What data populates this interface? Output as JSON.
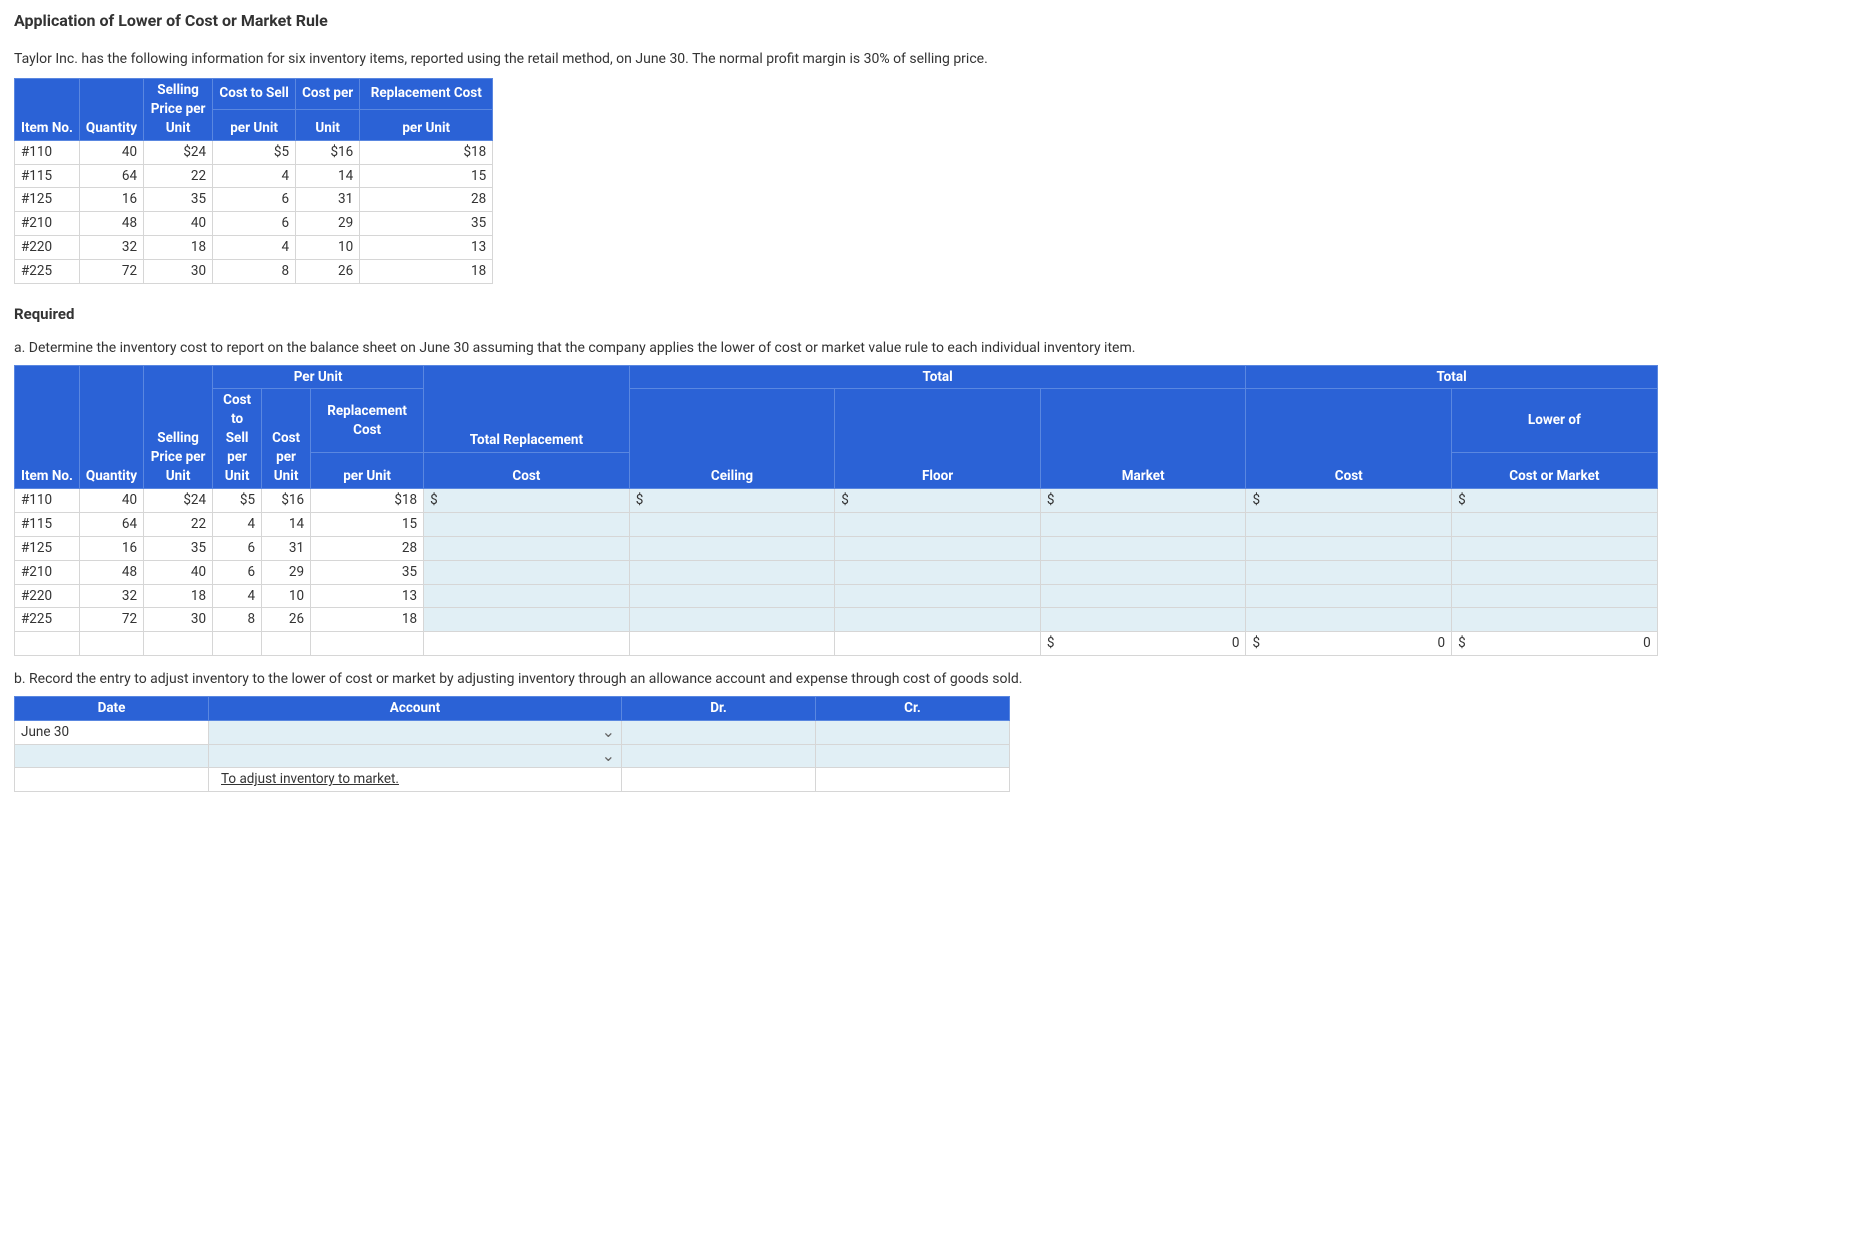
{
  "title": "Application of Lower of Cost or Market Rule",
  "intro": "Taylor Inc. has the following information for six inventory items, reported using the retail method, on June 30. The normal profit margin is 30% of selling price.",
  "table1": {
    "headers": {
      "item_no": "Item No.",
      "quantity": "Quantity",
      "selling_price": "Selling Price per Unit",
      "cost_to_sell": "Cost to Sell",
      "cost_to_sell_sub": "per Unit",
      "cost_per": "Cost per",
      "cost_per_sub": "Unit",
      "replacement": "Replacement Cost",
      "replacement_sub": "per Unit"
    },
    "rows": [
      {
        "item": "#110",
        "qty": "40",
        "sp": "$24",
        "cts": "$5",
        "cpu": "$16",
        "rc": "$18"
      },
      {
        "item": "#115",
        "qty": "64",
        "sp": "22",
        "cts": "4",
        "cpu": "14",
        "rc": "15"
      },
      {
        "item": "#125",
        "qty": "16",
        "sp": "35",
        "cts": "6",
        "cpu": "31",
        "rc": "28"
      },
      {
        "item": "#210",
        "qty": "48",
        "sp": "40",
        "cts": "6",
        "cpu": "29",
        "rc": "35"
      },
      {
        "item": "#220",
        "qty": "32",
        "sp": "18",
        "cts": "4",
        "cpu": "10",
        "rc": "13"
      },
      {
        "item": "#225",
        "qty": "72",
        "sp": "30",
        "cts": "8",
        "cpu": "26",
        "rc": "18"
      }
    ]
  },
  "required_label": "Required",
  "part_a": "a. Determine the inventory cost to report on the balance sheet on June 30 assuming that the company applies the lower of cost or market value rule to each individual inventory item.",
  "table2": {
    "headers": {
      "per_unit": "Per Unit",
      "total1": "Total",
      "total2": "Total",
      "item_no": "Item No.",
      "quantity": "Quantity",
      "selling_price": "Selling Price per Unit",
      "cost_to_sell": "Cost to Sell per Unit",
      "cost_per": "Cost per Unit",
      "replacement": "Replacement Cost",
      "replacement_sub": "per Unit",
      "total_replacement": "Total Replacement",
      "total_replacement_sub": "Cost",
      "ceiling": "Ceiling",
      "floor": "Floor",
      "market": "Market",
      "cost": "Cost",
      "lower_of": "Lower of",
      "lower_of_sub": "Cost or Market"
    },
    "rows": [
      {
        "item": "#110",
        "qty": "40",
        "sp": "$24",
        "cts": "$5",
        "cpu": "$16",
        "rc": "$18"
      },
      {
        "item": "#115",
        "qty": "64",
        "sp": "22",
        "cts": "4",
        "cpu": "14",
        "rc": "15"
      },
      {
        "item": "#125",
        "qty": "16",
        "sp": "35",
        "cts": "6",
        "cpu": "31",
        "rc": "28"
      },
      {
        "item": "#210",
        "qty": "48",
        "sp": "40",
        "cts": "6",
        "cpu": "29",
        "rc": "35"
      },
      {
        "item": "#220",
        "qty": "32",
        "sp": "18",
        "cts": "4",
        "cpu": "10",
        "rc": "13"
      },
      {
        "item": "#225",
        "qty": "72",
        "sp": "30",
        "cts": "8",
        "cpu": "26",
        "rc": "18"
      }
    ],
    "totals": {
      "market": "0",
      "cost": "0",
      "lower": "0"
    }
  },
  "dollar_sign": "$",
  "part_b": "b. Record the entry to adjust inventory to the lower of cost or market by adjusting inventory through an allowance account and expense through cost of goods sold.",
  "table3": {
    "headers": {
      "date": "Date",
      "account": "Account",
      "dr": "Dr.",
      "cr": "Cr."
    },
    "rows": [
      {
        "date": "June 30"
      },
      {
        "date": ""
      }
    ],
    "footnote": "To adjust inventory to market."
  },
  "chevron": "⌄"
}
